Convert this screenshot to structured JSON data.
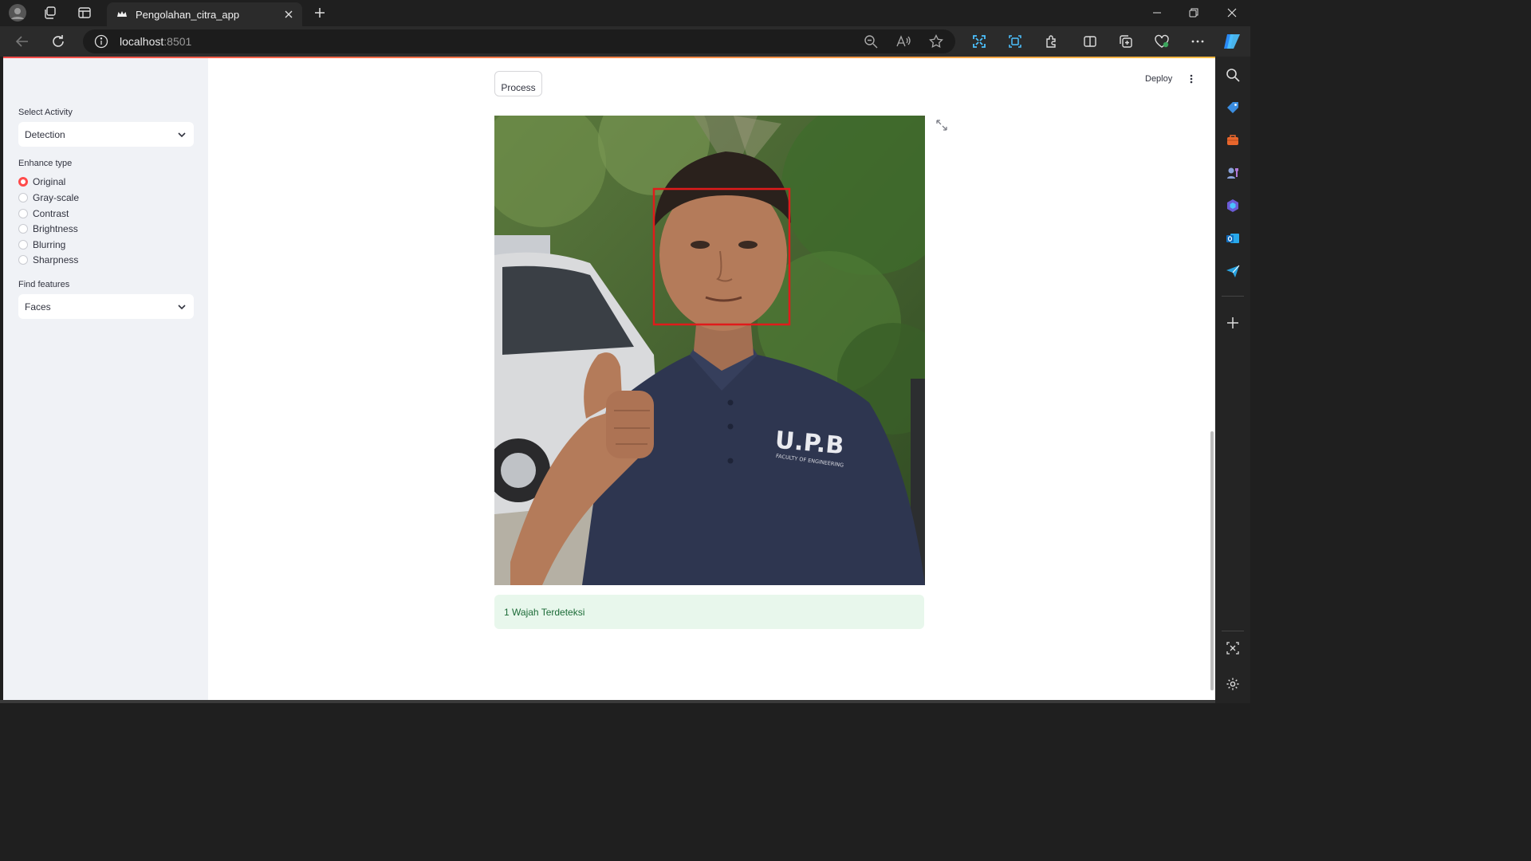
{
  "browser": {
    "tab_title": "Pengolahan_citra_app",
    "url_host": "localhost",
    "url_port": ":8501"
  },
  "app": {
    "header": {
      "deploy_label": "Deploy"
    },
    "sidebar": {
      "activity": {
        "label": "Select Activity",
        "value": "Detection"
      },
      "enhance": {
        "label": "Enhance type",
        "options": [
          "Original",
          "Gray-scale",
          "Contrast",
          "Brightness",
          "Blurring",
          "Sharpness"
        ],
        "selected": "Original"
      },
      "features": {
        "label": "Find features",
        "value": "Faces"
      }
    },
    "main": {
      "process_button": "Process",
      "result_message": "1 Wajah Terdeteksi",
      "shirt_print": "U.P.B",
      "shirt_subprint": "FACULTY OF ENGINEERING"
    }
  },
  "colors": {
    "accent": "#ff4b4b",
    "sidebar_bg": "#f0f2f6",
    "success_bg": "#e8f7ec",
    "success_text": "#1c6b37",
    "detection_box": "#e01b1b"
  }
}
